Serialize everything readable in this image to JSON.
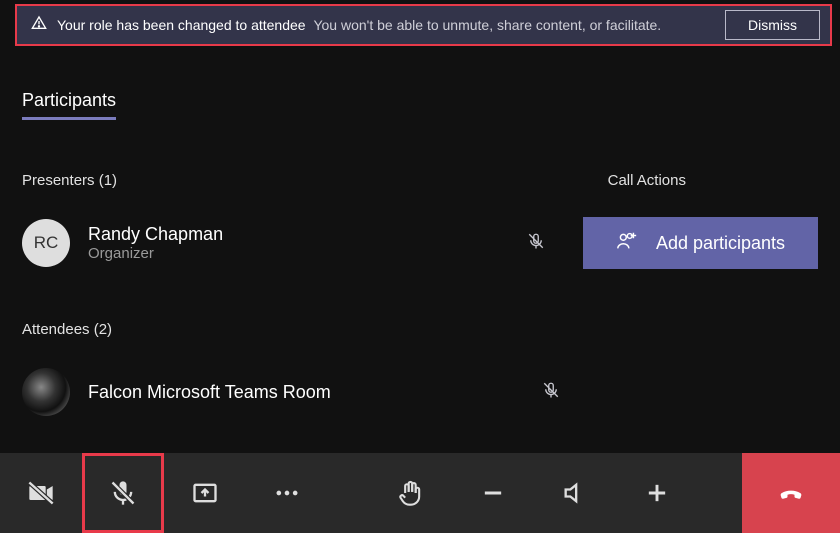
{
  "banner": {
    "title": "Your role has been changed to attendee",
    "subtitle": "You won't be able to unmute, share content, or facilitate.",
    "dismiss_label": "Dismiss"
  },
  "participants_header": "Participants",
  "presenters_header": "Presenters (1)",
  "call_actions_header": "Call Actions",
  "presenter": {
    "initials": "RC",
    "name": "Randy Chapman",
    "role": "Organizer"
  },
  "add_participants_label": "Add participants",
  "attendees_header": "Attendees (2)",
  "attendee": {
    "name": "Falcon Microsoft Teams Room"
  }
}
